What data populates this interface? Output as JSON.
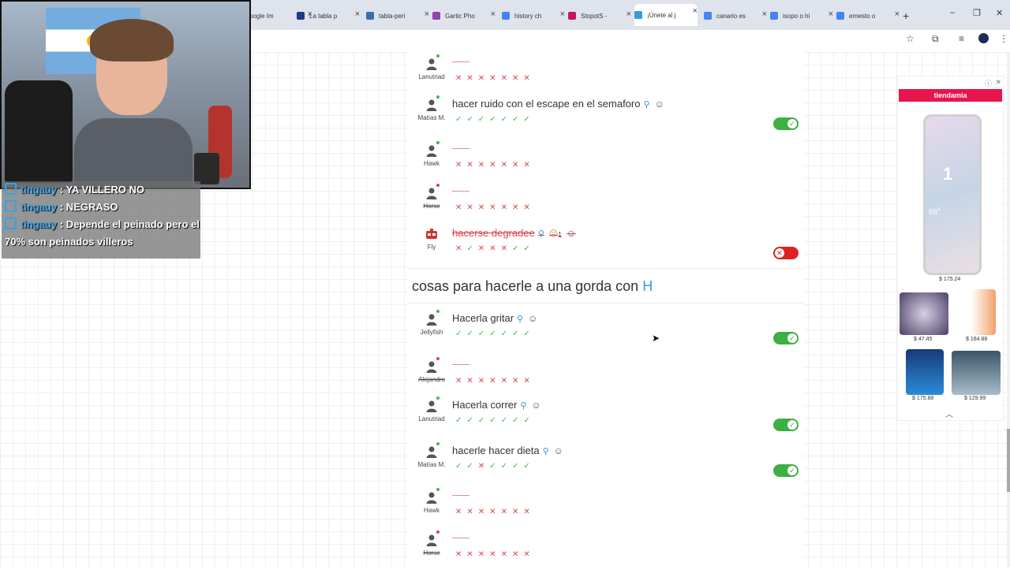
{
  "tabs": [
    {
      "label": "oogle Im",
      "color": "#4285f4"
    },
    {
      "label": "La tabla p",
      "color": "#1e3a8a"
    },
    {
      "label": "tabla-peri",
      "color": "#3b6ea5"
    },
    {
      "label": "Gartic Pho",
      "color": "#8e44ad"
    },
    {
      "label": "history ch",
      "color": "#4285f4"
    },
    {
      "label": "StopotS -",
      "color": "#c2185b"
    },
    {
      "label": "¡Únete al j",
      "color": "#3a9ad9"
    },
    {
      "label": "canario es",
      "color": "#4285f4"
    },
    {
      "label": "isopo o hi",
      "color": "#4285f4"
    },
    {
      "label": "ernesto o",
      "color": "#4285f4"
    }
  ],
  "tab_close": "×",
  "new_tab": "+",
  "window": {
    "minimize": "–",
    "restore": "❐",
    "close": "✕"
  },
  "toolbar_icons": {
    "star": "☆",
    "extensions": "⧉",
    "media": "≡",
    "menu": "⋮"
  },
  "chat": [
    {
      "user": "tingauy",
      "text": ": YA VILLERO NO"
    },
    {
      "user": "tingauy",
      "text": ": NEGRASO"
    },
    {
      "user": "tingauy",
      "text": ": Depende el peinado pero el 70% son peinados villeros"
    }
  ],
  "colors": {
    "valid": "#3cb043",
    "invalid": "#e02020",
    "online": "#3fb950",
    "offline": "#e0434b"
  },
  "section1": [
    {
      "player": "Lanutriad",
      "status": "online",
      "answer": "",
      "votes": [
        "x",
        "x",
        "x",
        "x",
        "x",
        "x",
        "x"
      ]
    },
    {
      "player": "Matías M.",
      "status": "online",
      "answer": "hacer ruido con el escape en el semaforo",
      "votes": [
        "v",
        "v",
        "v",
        "v",
        "v",
        "v",
        "v"
      ],
      "toggle": "on"
    },
    {
      "player": "Hawk",
      "status": "online",
      "answer": "",
      "votes": [
        "x",
        "x",
        "x",
        "x",
        "x",
        "x",
        "x"
      ]
    },
    {
      "player": "Horse",
      "status": "offline",
      "answer": "",
      "votes": [
        "x",
        "x",
        "x",
        "x",
        "x",
        "x",
        "x"
      ],
      "strike_name": true
    },
    {
      "player": "Fly",
      "status": "robot",
      "answer": "hacerse degradee",
      "strike": true,
      "angry": "1",
      "votes": [
        "x",
        "v",
        "x",
        "x",
        "x",
        "v",
        "v"
      ],
      "toggle": "off"
    }
  ],
  "category": {
    "title": "cosas para hacerle a una gorda con",
    "letter": "H"
  },
  "section2": [
    {
      "player": "Jellyfish",
      "status": "online",
      "answer": "Hacerla gritar",
      "votes": [
        "v",
        "v",
        "v",
        "v",
        "v",
        "v",
        "v"
      ],
      "toggle": "on"
    },
    {
      "player": "Alejandro",
      "status": "offline",
      "answer": "",
      "votes": [
        "x",
        "x",
        "x",
        "x",
        "x",
        "x",
        "x"
      ],
      "strike_name": true
    },
    {
      "player": "Lanutriad",
      "status": "online",
      "answer": "Hacerla correr",
      "votes": [
        "v",
        "v",
        "v",
        "v",
        "v",
        "v",
        "v"
      ],
      "toggle": "on"
    },
    {
      "player": "Matías M.",
      "status": "online",
      "answer": "hacerle hacer dieta",
      "votes": [
        "v",
        "v",
        "x",
        "v",
        "v",
        "v",
        "v"
      ],
      "toggle": "on"
    },
    {
      "player": "Hawk",
      "status": "online",
      "answer": "",
      "votes": [
        "x",
        "x",
        "x",
        "x",
        "x",
        "x",
        "x"
      ]
    },
    {
      "player": "Horse",
      "status": "offline",
      "answer": "",
      "votes": [
        "x",
        "x",
        "x",
        "x",
        "x",
        "x",
        "x"
      ],
      "strike_name": true
    }
  ],
  "ad": {
    "brand": "tiendamia",
    "phone_time": "1",
    "phone_temp": "68°",
    "prices": [
      "$ 175.24",
      "$ 47.45",
      "$ 184.88",
      "$ 175.88",
      "$ 129.99"
    ]
  }
}
